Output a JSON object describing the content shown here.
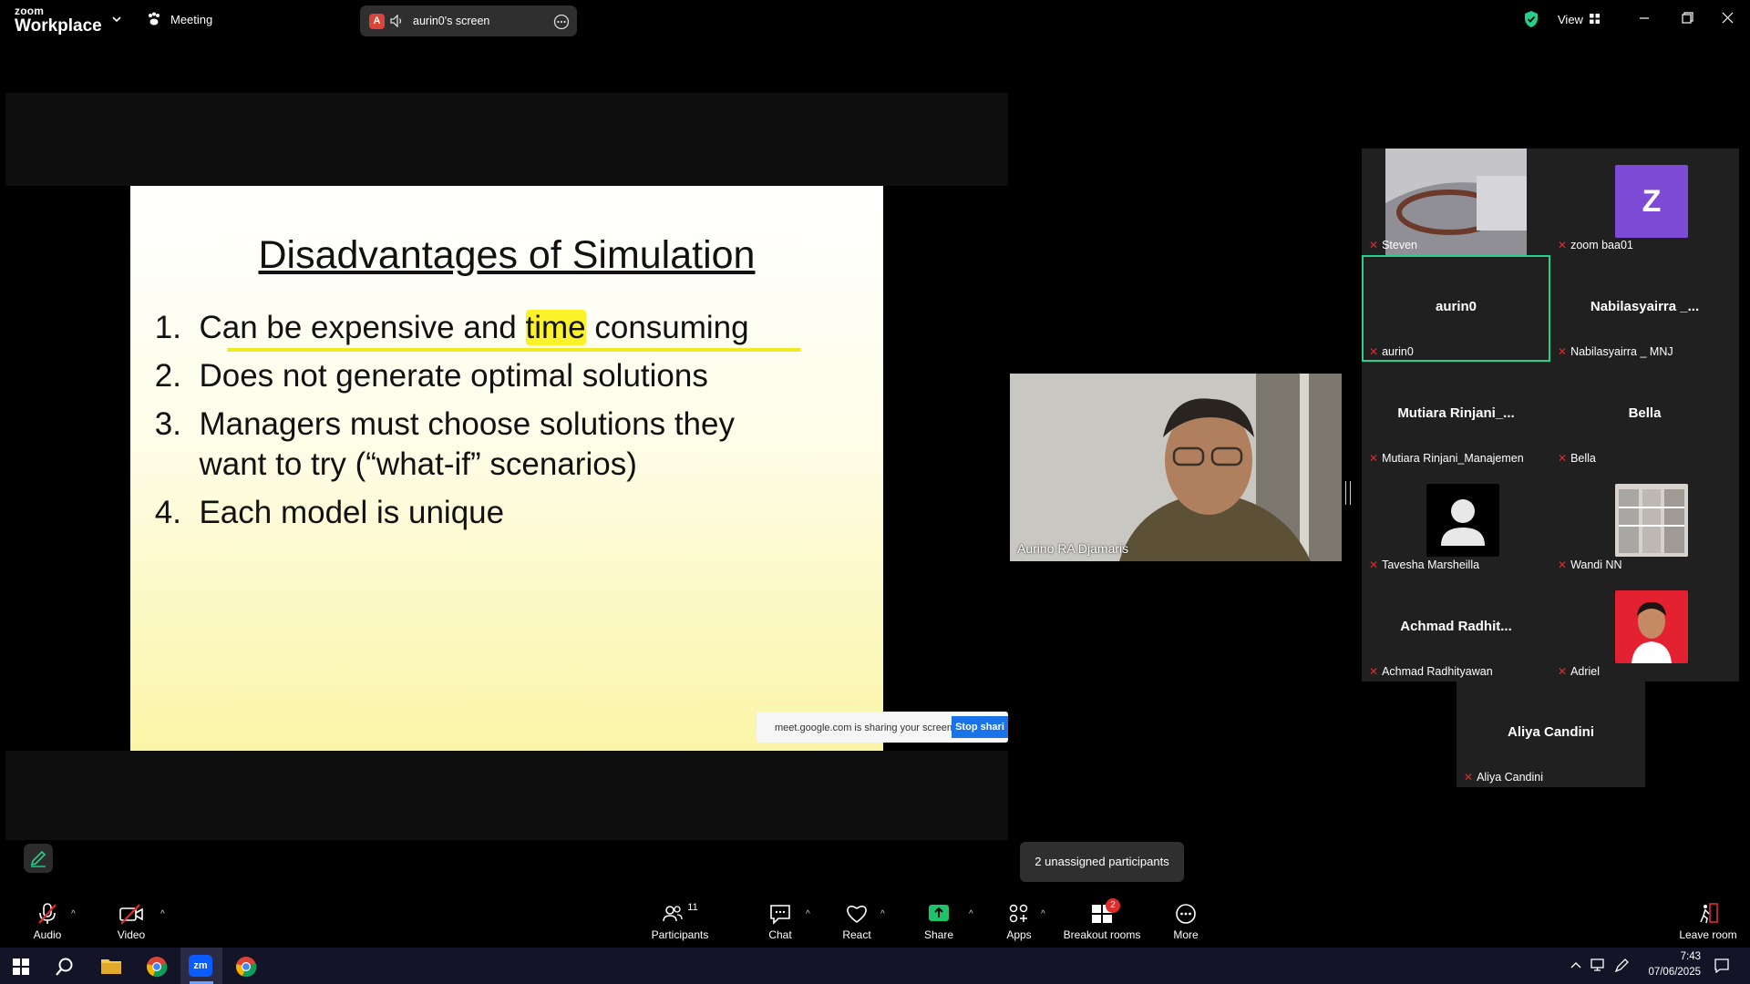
{
  "titlebar": {
    "logo_top": "zoom",
    "logo_bottom": "Workplace",
    "meeting_label": "Meeting",
    "screen_badge": "A",
    "screen_label": "aurin0's screen",
    "view_label": "View"
  },
  "slide": {
    "title": "Disadvantages of Simulation",
    "items": [
      {
        "num": "1.",
        "pre": "Can be expensive and ",
        "hl": "time",
        "post": " consuming"
      },
      {
        "num": "2.",
        "text": "Does not generate optimal solutions"
      },
      {
        "num": "3.",
        "text": "Managers must choose solutions they"
      },
      {
        "num": "",
        "text": "want to try (“what-if” scenarios)"
      },
      {
        "num": "4.",
        "text": "Each model is unique"
      }
    ],
    "share_notice": "meet.google.com is sharing your screen.",
    "share_button": "Stop shari"
  },
  "speaker": {
    "name": "Aurino RA Djamaris"
  },
  "participants": [
    {
      "label": "Steven",
      "type": "video"
    },
    {
      "label": "zoom baa01",
      "type": "avatar",
      "initial": "Z",
      "color": "#7e4bd6"
    },
    {
      "label": "aurin0",
      "type": "name",
      "display": "aurin0",
      "active": true
    },
    {
      "label": "Nabilasyairra _ MNJ",
      "type": "name",
      "display": "Nabilasyairra _..."
    },
    {
      "label": "Mutiara Rinjani_Manajemen",
      "type": "name",
      "display": "Mutiara Rinjani_..."
    },
    {
      "label": "Bella",
      "type": "name",
      "display": "Bella"
    },
    {
      "label": "Tavesha Marsheilla",
      "type": "default-avatar"
    },
    {
      "label": "Wandi NN",
      "type": "photo"
    },
    {
      "label": "Achmad Radhityawan",
      "type": "name",
      "display": "Achmad Radhit..."
    },
    {
      "label": "Adriel",
      "type": "portrait"
    },
    {
      "label": "Aliya Candini",
      "type": "name",
      "display": "Aliya Candini"
    }
  ],
  "unassigned": "2 unassigned participants",
  "toolbar": {
    "audio": "Audio",
    "video": "Video",
    "participants": "Participants",
    "participants_count": "11",
    "chat": "Chat",
    "react": "React",
    "share": "Share",
    "apps": "Apps",
    "breakout": "Breakout rooms",
    "breakout_badge": "2",
    "more": "More",
    "leave": "Leave room"
  },
  "taskbar": {
    "time": "7:43",
    "date": "07/06/2025"
  },
  "colors": {
    "accent_green": "#23d18b",
    "mute_red": "#e02b2b",
    "share_green": "#1ec26b",
    "zoom_blue": "#0b5cff"
  }
}
